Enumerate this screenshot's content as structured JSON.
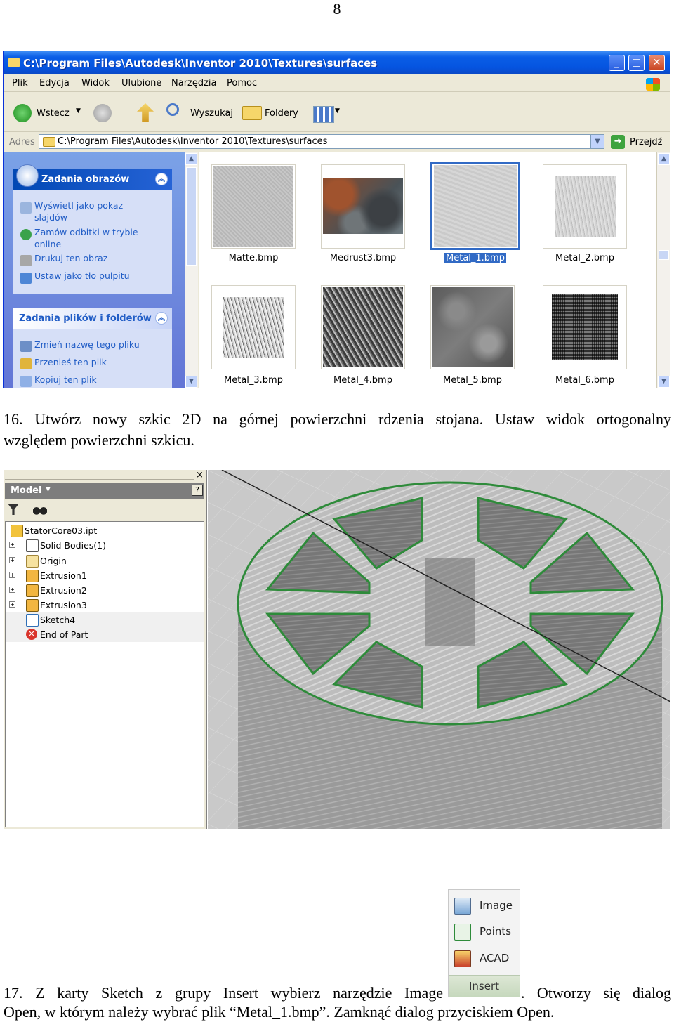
{
  "page_number": "8",
  "explorer": {
    "title": "C:\\Program Files\\Autodesk\\Inventor 2010\\Textures\\surfaces",
    "menu": [
      "Plik",
      "Edycja",
      "Widok",
      "Ulubione",
      "Narzędzia",
      "Pomoc"
    ],
    "toolbar": {
      "back": "Wstecz",
      "search": "Wyszukaj",
      "folders": "Foldery"
    },
    "address_label": "Adres",
    "address_value": "C:\\Program Files\\Autodesk\\Inventor 2010\\Textures\\surfaces",
    "go_label": "Przejdź",
    "picture_tasks": {
      "title": "Zadania obrazów",
      "items": [
        "Wyświetl jako pokaz slajdów",
        "Zamów odbitki w trybie online",
        "Drukuj ten obraz",
        "Ustaw jako tło pulpitu"
      ]
    },
    "file_tasks": {
      "title": "Zadania plików i folderów",
      "items": [
        "Zmień nazwę tego pliku",
        "Przenieś ten plik",
        "Kopiuj ten plik"
      ]
    },
    "files": [
      {
        "name": "Matte.bmp"
      },
      {
        "name": "Medrust3.bmp"
      },
      {
        "name": "Metal_1.bmp",
        "selected": true
      },
      {
        "name": "Metal_2.bmp"
      },
      {
        "name": "Metal_3.bmp"
      },
      {
        "name": "Metal_4.bmp"
      },
      {
        "name": "Metal_5.bmp"
      },
      {
        "name": "Metal_6.bmp"
      }
    ]
  },
  "step16": {
    "line1": "16. Utwórz nowy szkic 2D na górnej powierzchni rdzenia stojana. Ustaw widok ortogonalny",
    "line2": "względem powierzchni szkicu."
  },
  "inventor": {
    "panel_title": "Model",
    "help_glyph": "?",
    "close_glyph": "×",
    "tree": [
      {
        "label": "StatorCore03.ipt"
      },
      {
        "label": "Solid Bodies(1)"
      },
      {
        "label": "Origin"
      },
      {
        "label": "Extrusion1"
      },
      {
        "label": "Extrusion2"
      },
      {
        "label": "Extrusion3"
      },
      {
        "label": "Sketch4"
      },
      {
        "label": "End of Part"
      }
    ]
  },
  "insert_panel": {
    "items": [
      "Image",
      "Points",
      "ACAD"
    ],
    "footer": "Insert"
  },
  "step17": {
    "line1_left": "17. Z karty Sketch z grupy Insert wybierz narzędzie Image",
    "line1_right": ". Otworzy się dialog",
    "line2": "Open, w którym należy wybrać plik “Metal_1.bmp”. Zamknąć dialog przyciskiem Open."
  }
}
